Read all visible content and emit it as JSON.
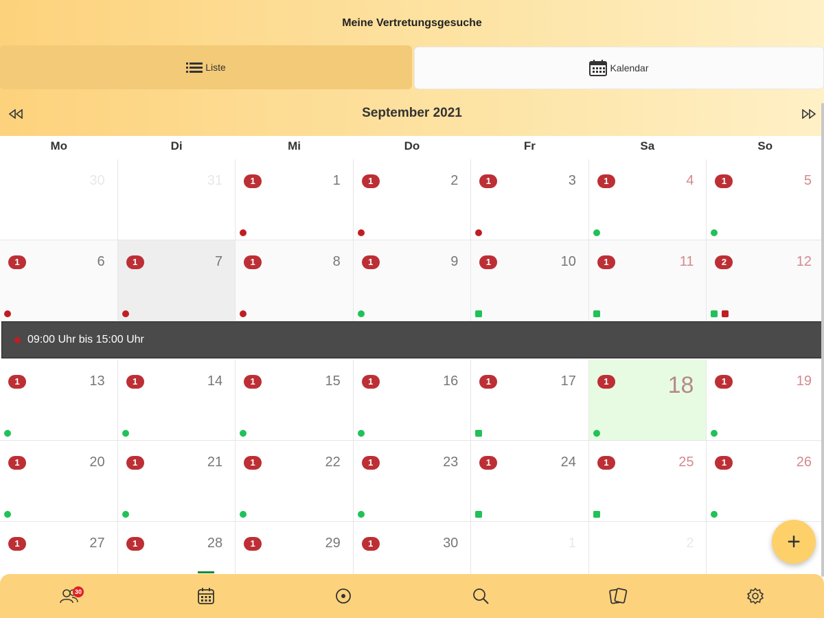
{
  "header": {
    "title": "Meine Vertretungsgesuche"
  },
  "tabs": {
    "list_label": "Liste",
    "calendar_label": "Kalendar"
  },
  "calendar": {
    "month_title": "September 2021",
    "weekdays": [
      "Mo",
      "Di",
      "Mi",
      "Do",
      "Fr",
      "Sa",
      "So"
    ],
    "rows": [
      [
        {
          "day": "30"
        },
        {
          "day": "31"
        },
        {
          "day": "1",
          "badge": "1"
        },
        {
          "day": "2",
          "badge": "1"
        },
        {
          "day": "3",
          "badge": "1"
        },
        {
          "day": "4",
          "badge": "1"
        },
        {
          "day": "5",
          "badge": "1"
        }
      ],
      [
        {
          "day": "6",
          "badge": "1"
        },
        {
          "day": "7",
          "badge": "1"
        },
        {
          "day": "8",
          "badge": "1"
        },
        {
          "day": "9",
          "badge": "1"
        },
        {
          "day": "10",
          "badge": "1"
        },
        {
          "day": "11",
          "badge": "1"
        },
        {
          "day": "12",
          "badge": "2"
        }
      ],
      [
        {
          "day": "13",
          "badge": "1"
        },
        {
          "day": "14",
          "badge": "1"
        },
        {
          "day": "15",
          "badge": "1"
        },
        {
          "day": "16",
          "badge": "1"
        },
        {
          "day": "17",
          "badge": "1"
        },
        {
          "day": "18",
          "badge": "1"
        },
        {
          "day": "19",
          "badge": "1"
        }
      ],
      [
        {
          "day": "20",
          "badge": "1"
        },
        {
          "day": "21",
          "badge": "1"
        },
        {
          "day": "22",
          "badge": "1"
        },
        {
          "day": "23",
          "badge": "1"
        },
        {
          "day": "24",
          "badge": "1"
        },
        {
          "day": "25",
          "badge": "1"
        },
        {
          "day": "26",
          "badge": "1"
        }
      ],
      [
        {
          "day": "27",
          "badge": "1"
        },
        {
          "day": "28",
          "badge": "1"
        },
        {
          "day": "29",
          "badge": "1"
        },
        {
          "day": "30",
          "badge": "1"
        },
        {
          "day": "1"
        },
        {
          "day": "2"
        },
        {
          "day": ""
        }
      ]
    ],
    "selected_event": {
      "time_text": "09:00 Uhr bis 15:00 Uhr"
    }
  },
  "fab": {
    "icon": "plus-icon",
    "label": "+"
  },
  "bottom_nav": {
    "items": [
      {
        "name": "users-icon",
        "badge": "30"
      },
      {
        "name": "calendar-icon"
      },
      {
        "name": "target-icon"
      },
      {
        "name": "search-icon"
      },
      {
        "name": "cards-icon"
      },
      {
        "name": "settings-icon"
      }
    ]
  },
  "colors": {
    "accent": "#fdd27c",
    "badge_red": "#bc2f35",
    "dot_red": "#c01e22",
    "dot_green": "#21c159",
    "today_bg": "#e7fbe3"
  }
}
